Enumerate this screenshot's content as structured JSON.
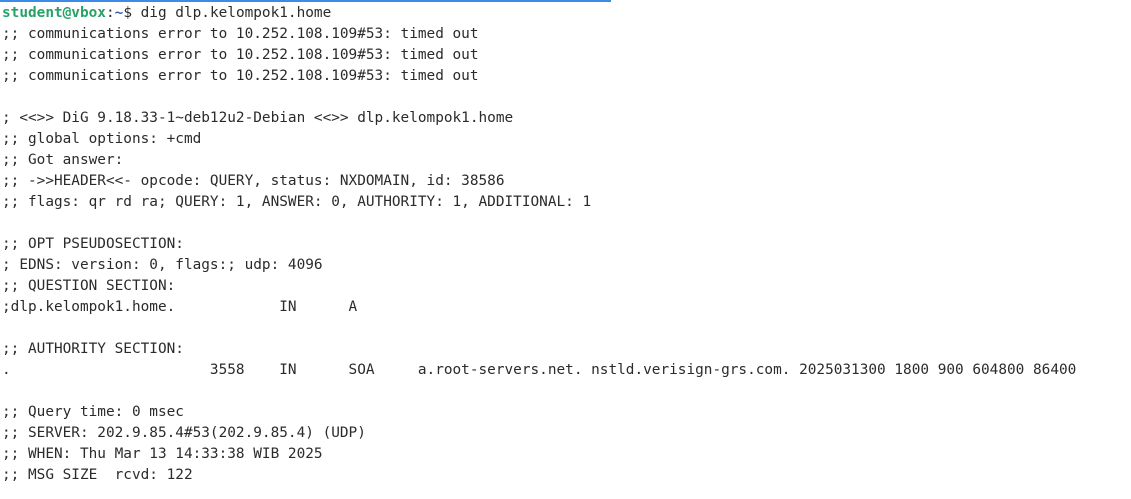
{
  "progress": 0.54,
  "colors": {
    "background": "#ffffff",
    "text": "#2b2b2b",
    "prompt_user": "#26a269",
    "prompt_path": "#3465a4",
    "progress": "#3c8ce7"
  },
  "prompt": {
    "user_host": "student@vbox",
    "separator": ":",
    "path": "~",
    "symbol": "$ ",
    "command": "dig dlp.kelompok1.home"
  },
  "output_lines": [
    ";; communications error to 10.252.108.109#53: timed out",
    ";; communications error to 10.252.108.109#53: timed out",
    ";; communications error to 10.252.108.109#53: timed out",
    "",
    "; <<>> DiG 9.18.33-1~deb12u2-Debian <<>> dlp.kelompok1.home",
    ";; global options: +cmd",
    ";; Got answer:",
    ";; ->>HEADER<<- opcode: QUERY, status: NXDOMAIN, id: 38586",
    ";; flags: qr rd ra; QUERY: 1, ANSWER: 0, AUTHORITY: 1, ADDITIONAL: 1",
    "",
    ";; OPT PSEUDOSECTION:",
    "; EDNS: version: 0, flags:; udp: 4096",
    ";; QUESTION SECTION:",
    ";dlp.kelompok1.home.            IN      A",
    "",
    ";; AUTHORITY SECTION:",
    ".                       3558    IN      SOA     a.root-servers.net. nstld.verisign-grs.com. 2025031300 1800 900 604800 86400",
    "",
    ";; Query time: 0 msec",
    ";; SERVER: 202.9.85.4#53(202.9.85.4) (UDP)",
    ";; WHEN: Thu Mar 13 14:33:38 WIB 2025",
    ";; MSG SIZE  rcvd: 122"
  ]
}
